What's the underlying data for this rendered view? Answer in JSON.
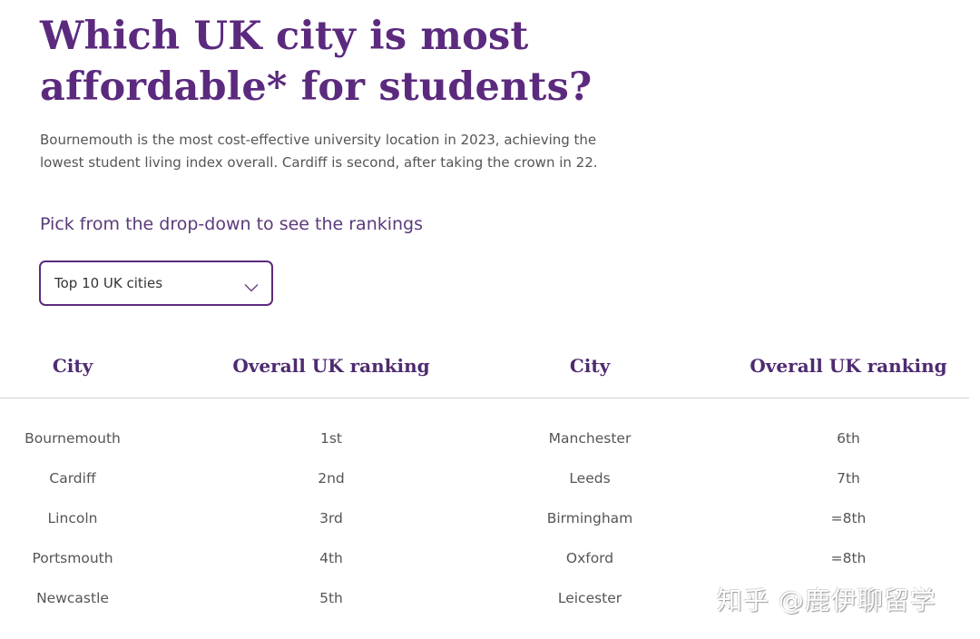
{
  "header": {
    "title_line1": "Which UK city is most",
    "title_line2": "affordable* for students?",
    "intro_line1": "Bournemouth is the most cost-effective university location in 2023, achieving the",
    "intro_line2": "lowest student living index overall. Cardiff is second, after taking the crown in 22."
  },
  "picker": {
    "label": "Pick from the drop-down to see the rankings",
    "selected": "Top 10 UK cities",
    "icon": "chevron-down-icon"
  },
  "table": {
    "columns": [
      "City",
      "Overall UK ranking",
      "City",
      "Overall UK ranking"
    ],
    "left_rows": [
      {
        "city": "Bournemouth",
        "rank": "1st"
      },
      {
        "city": "Cardiff",
        "rank": "2nd"
      },
      {
        "city": "Lincoln",
        "rank": "3rd"
      },
      {
        "city": "Portsmouth",
        "rank": "4th"
      },
      {
        "city": "Newcastle",
        "rank": "5th"
      }
    ],
    "right_rows": [
      {
        "city": "Manchester",
        "rank": "6th"
      },
      {
        "city": "Leeds",
        "rank": "7th"
      },
      {
        "city": "Birmingham",
        "rank": "=8th"
      },
      {
        "city": "Oxford",
        "rank": "=8th"
      },
      {
        "city": "Leicester",
        "rank": ""
      }
    ]
  },
  "watermark": {
    "text": "知乎 @鹿伊聊留学"
  },
  "colors": {
    "brand_purple": "#5b2a7e",
    "header_purple": "#4e2b70",
    "body_text": "#555555",
    "divider": "#d0d0d0"
  }
}
